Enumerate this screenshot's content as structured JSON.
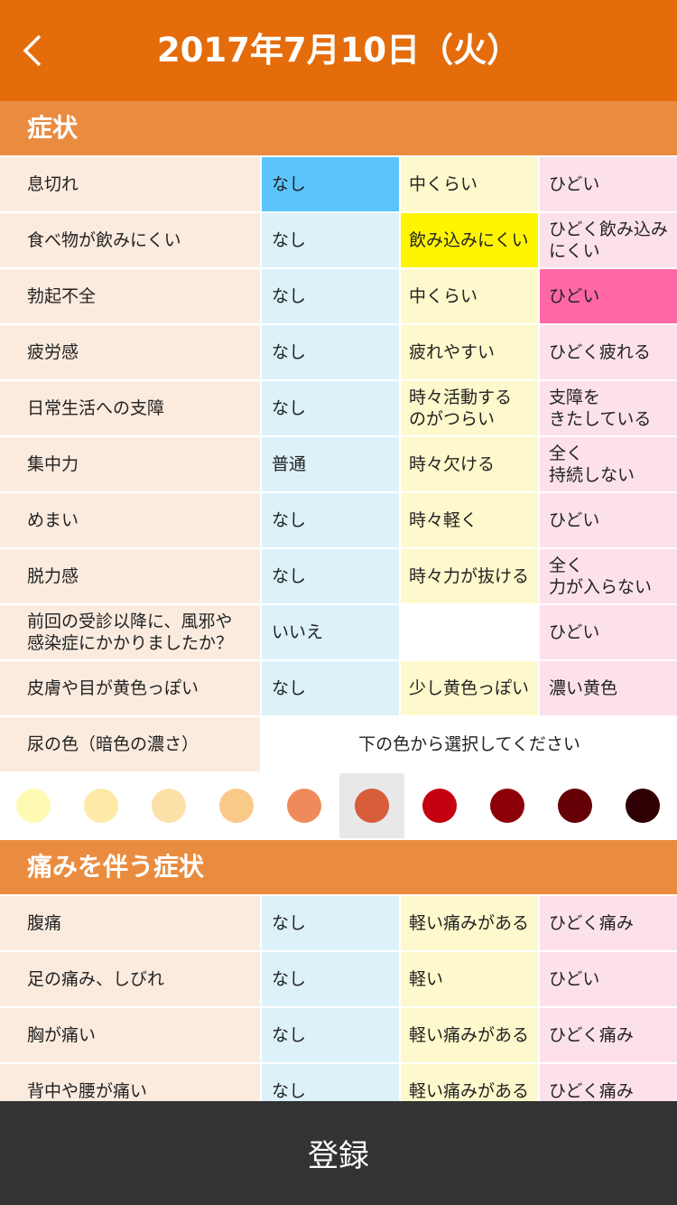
{
  "header": {
    "title": "2017年7月10日（火）"
  },
  "sections": {
    "symptoms": "症状",
    "pain": "痛みを伴う症状"
  },
  "rows": [
    {
      "label": "息切れ",
      "c1": "なし",
      "c2": "中くらい",
      "c3": "ひどい",
      "selected": 1
    },
    {
      "label": "食べ物が飲みにくい",
      "c1": "なし",
      "c2": "飲み込みにくい",
      "c3": "ひどく飲み込み\nにくい",
      "selected": 2
    },
    {
      "label": "勃起不全",
      "c1": "なし",
      "c2": "中くらい",
      "c3": "ひどい",
      "selected": 3
    },
    {
      "label": "疲労感",
      "c1": "なし",
      "c2": "疲れやすい",
      "c3": "ひどく疲れる",
      "selected": 0
    },
    {
      "label": "日常生活への支障",
      "c1": "なし",
      "c2": "時々活動する\nのがつらい",
      "c3": "支障を\nきたしている",
      "selected": 0
    },
    {
      "label": "集中力",
      "c1": "普通",
      "c2": "時々欠ける",
      "c3": "全く\n持続しない",
      "selected": 0
    },
    {
      "label": "めまい",
      "c1": "なし",
      "c2": "時々軽く",
      "c3": "ひどい",
      "selected": 0
    },
    {
      "label": "脱力感",
      "c1": "なし",
      "c2": "時々力が抜ける",
      "c3": "全く\n力が入らない",
      "selected": 0
    },
    {
      "label": "前回の受診以降に、風邪や\n感染症にかかりましたか？",
      "c1": "いいえ",
      "c2": "",
      "c3": "ひどい",
      "selected": 0
    },
    {
      "label": "皮膚や目が黄色っぽい",
      "c1": "なし",
      "c2": "少し黄色っぽい",
      "c3": "濃い黄色",
      "selected": 0
    }
  ],
  "urine": {
    "label": "尿の色（暗色の濃さ）",
    "instruction": "下の色から選択してください"
  },
  "urine_colors": [
    "#fefab4",
    "#feeaa6",
    "#fde0a8",
    "#f9c988",
    "#ef8a5b",
    "#d75d3b",
    "#c50010",
    "#8e0008",
    "#650006",
    "#2f0004"
  ],
  "urine_selected_index": 5,
  "pain_rows": [
    {
      "label": "腹痛",
      "c1": "なし",
      "c2": "軽い痛みがある",
      "c3": "ひどく痛み",
      "selected": 0
    },
    {
      "label": "足の痛み、しびれ",
      "c1": "なし",
      "c2": "軽い",
      "c3": "ひどい",
      "selected": 0
    },
    {
      "label": "胸が痛い",
      "c1": "なし",
      "c2": "軽い痛みがある",
      "c3": "ひどく痛み",
      "selected": 0
    },
    {
      "label": "背中や腰が痛い",
      "c1": "なし",
      "c2": "軽い痛みがある",
      "c3": "ひどく痛み",
      "selected": 0
    }
  ],
  "footer": {
    "register_label": "登録"
  },
  "colors": {
    "header": "#e46c0b",
    "section": "#ea8c3f",
    "selected_none": "#5bc5fb",
    "selected_mid": "#fff500",
    "selected_severe": "#ff68a5",
    "footer": "#333333"
  },
  "icons": {
    "back": "chevron-left-icon"
  }
}
